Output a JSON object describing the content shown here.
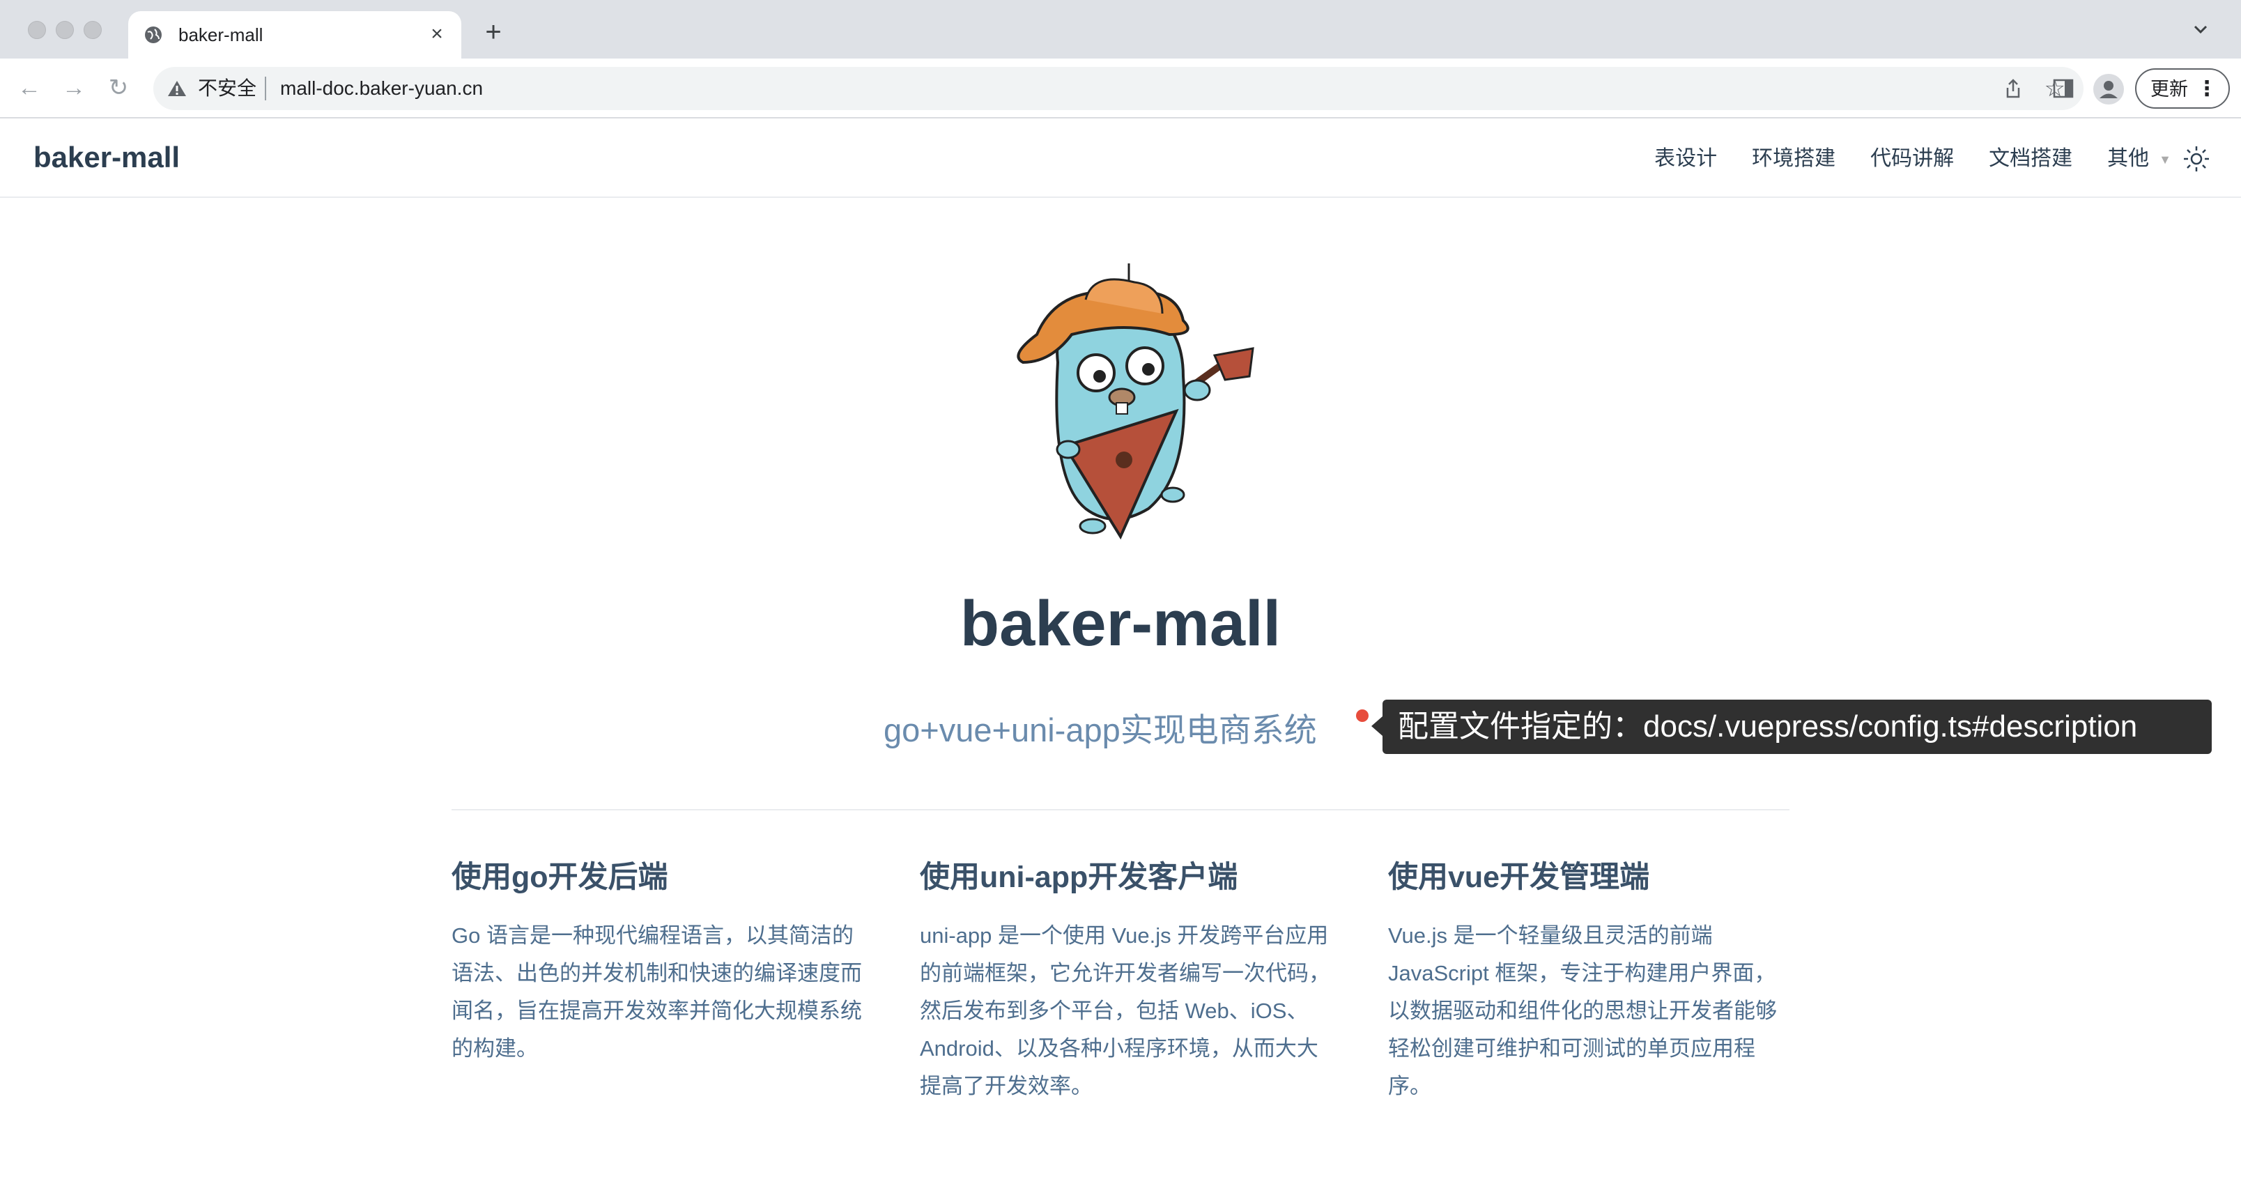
{
  "browser": {
    "tab_title": "baker-mall",
    "security_label": "不安全",
    "url": "mall-doc.baker-yuan.cn",
    "update_label": "更新"
  },
  "navbar": {
    "brand": "baker-mall",
    "links": [
      "表设计",
      "环境搭建",
      "代码讲解",
      "文档搭建",
      "其他"
    ]
  },
  "hero": {
    "title": "baker-mall",
    "description": "go+vue+uni-app实现电商系统",
    "tooltip": "配置文件指定的：docs/.vuepress/config.ts#description"
  },
  "features": [
    {
      "title": "使用go开发后端",
      "details": "Go 语言是一种现代编程语言，以其简洁的语法、出色的并发机制和快速的编译速度而闻名，旨在提高开发效率并简化大规模系统的构建。"
    },
    {
      "title": "使用uni-app开发客户端",
      "details": "uni-app 是一个使用 Vue.js 开发跨平台应用的前端框架，它允许开发者编写一次代码，然后发布到多个平台，包括 Web、iOS、Android、以及各种小程序环境，从而大大提高了开发效率。"
    },
    {
      "title": "使用vue开发管理端",
      "details": "Vue.js 是一个轻量级且灵活的前端 JavaScript 框架，专注于构建用户界面，以数据驱动和组件化的思想让开发者能够轻松创建可维护和可测试的单页应用程序。"
    }
  ],
  "colors": {
    "accent": "#6a8bad",
    "title": "#2c3e50",
    "tooltip_bg": "#303030",
    "dot": "#e74c3c"
  }
}
